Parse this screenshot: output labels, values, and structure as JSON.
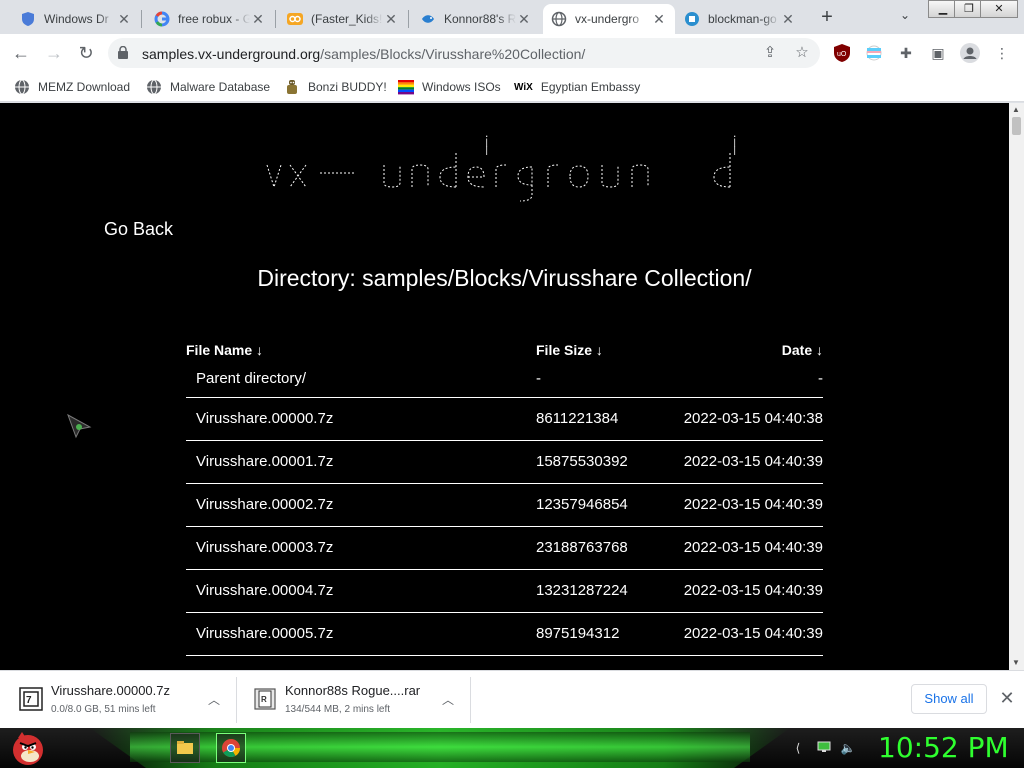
{
  "browser": {
    "tabs": [
      {
        "label": "Windows Dr",
        "icon": "shield-icon",
        "color": "#4a7bd8"
      },
      {
        "label": "free robux - G",
        "icon": "google-icon",
        "color": "#4285f4"
      },
      {
        "label": "(Faster_Kids!",
        "icon": "infinity-icon",
        "color": "#f5a623"
      },
      {
        "label": "Konnor88's R",
        "icon": "fish-icon",
        "color": "#2a7fd0"
      },
      {
        "label": "vx-undergro",
        "icon": "globe-icon",
        "color": "#5f6368"
      },
      {
        "label": "blockman-go",
        "icon": "blockman-icon",
        "color": "#2b8fcf"
      }
    ],
    "active_tab": 4,
    "url": {
      "host": "samples.vx-underground.org",
      "path": "/samples/Blocks/Virusshare%20Collection/"
    },
    "bookmarks": [
      {
        "label": "MEMZ Download",
        "icon": "globe-icon"
      },
      {
        "label": "Malware Database",
        "icon": "globe-icon"
      },
      {
        "label": "Bonzi BUDDY!",
        "icon": "bonzi-icon"
      },
      {
        "label": "Windows ISOs",
        "icon": "rainbow-flag-icon"
      },
      {
        "label": "Egyptian Embassy",
        "icon": "wix-icon",
        "icon_text": "WiX"
      }
    ]
  },
  "page": {
    "go_back": "Go Back",
    "directory_title": "Directory: samples/Blocks/Virusshare Collection/",
    "columns": {
      "name": "File Name  ↓",
      "size": "File Size  ↓",
      "date": "Date  ↓"
    },
    "parent": {
      "name": "Parent directory/",
      "size": "-",
      "date": "-"
    },
    "files": [
      {
        "name": "Virusshare.00000.7z",
        "size": "8611221384",
        "date": "2022-03-15 04:40:38"
      },
      {
        "name": "Virusshare.00001.7z",
        "size": "15875530392",
        "date": "2022-03-15 04:40:39"
      },
      {
        "name": "Virusshare.00002.7z",
        "size": "12357946854",
        "date": "2022-03-15 04:40:39"
      },
      {
        "name": "Virusshare.00003.7z",
        "size": "23188763768",
        "date": "2022-03-15 04:40:39"
      },
      {
        "name": "Virusshare.00004.7z",
        "size": "13231287224",
        "date": "2022-03-15 04:40:39"
      },
      {
        "name": "Virusshare.00005.7z",
        "size": "8975194312",
        "date": "2022-03-15 04:40:39"
      }
    ]
  },
  "downloads": {
    "items": [
      {
        "name": "Virusshare.00000.7z",
        "status": "0.0/8.0 GB, 51 mins left",
        "icon": "7z-file-icon"
      },
      {
        "name": "Konnor88s Rogue....rar",
        "status": "134/544 MB, 2 mins left",
        "icon": "rar-file-icon"
      }
    ],
    "show_all": "Show all"
  },
  "taskbar": {
    "clock": "10:52 PM",
    "accent": "#2fff2f"
  }
}
